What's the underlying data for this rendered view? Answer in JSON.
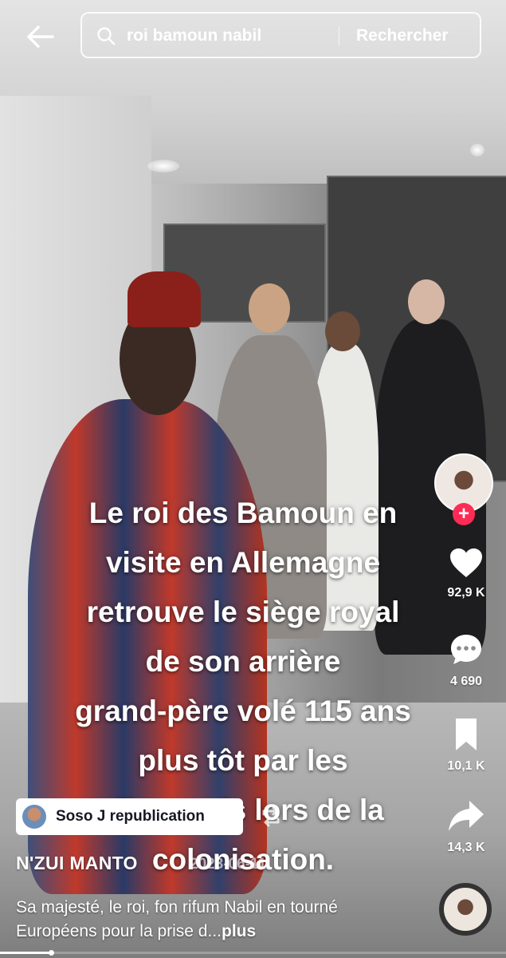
{
  "search": {
    "query": "roi bamoun nabil",
    "button_label": "Rechercher"
  },
  "video": {
    "overlay_lines": [
      "Le roi des Bamoun en",
      "visite en Allemagne",
      "retrouve le siège royal",
      "de son arrière",
      "grand-père volé 115 ans",
      "plus tôt par les",
      "allemands lors de la",
      "colonisation."
    ],
    "progress": 0.1
  },
  "actions": {
    "likes": "92,9 K",
    "comments": "4 690",
    "saves": "10,1 K",
    "shares": "14,3 K"
  },
  "repost": {
    "label": "Soso J republication"
  },
  "post": {
    "author": "N'ZUI MANTO",
    "date": "2023-06-11",
    "description": "Sa majesté, le roi, fon rifum Nabil en tourné  Européens pour la prise d...",
    "more_label": "plus"
  },
  "colors": {
    "follow": "#fe2c55",
    "text": "#ffffff",
    "repost_bg": "#ffffff"
  },
  "icons": [
    "back-arrow-icon",
    "search-icon",
    "plus-icon",
    "heart-icon",
    "comment-icon",
    "bookmark-icon",
    "share-icon",
    "repost-icon"
  ]
}
